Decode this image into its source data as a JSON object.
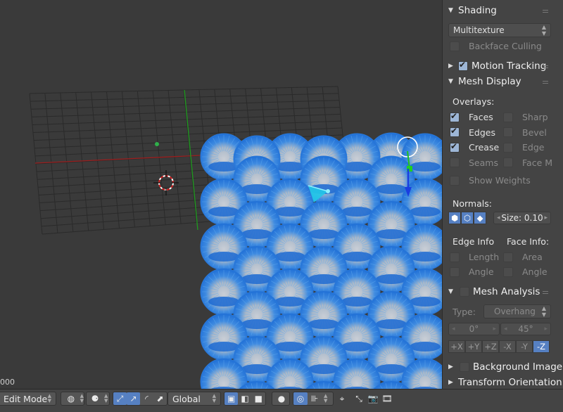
{
  "viewport": {
    "corner_text": "000"
  },
  "shading_panel": {
    "title": "Shading",
    "shading_mode": "Multitexture",
    "backface_culling": {
      "label": "Backface Culling",
      "checked": false
    }
  },
  "motion_tracking": {
    "title": "Motion Tracking",
    "checked": true
  },
  "mesh_display": {
    "title": "Mesh Display",
    "overlays_label": "Overlays:",
    "overlays": [
      {
        "label": "Faces",
        "checked": true
      },
      {
        "label": "Sharp",
        "checked": false
      },
      {
        "label": "Edges",
        "checked": true
      },
      {
        "label": "Bevel",
        "checked": false
      },
      {
        "label": "Crease",
        "checked": true
      },
      {
        "label": "Edge",
        "checked": false
      },
      {
        "label": "Seams",
        "checked": false
      },
      {
        "label": "Face M",
        "checked": false
      }
    ],
    "show_weights": {
      "label": "Show Weights",
      "checked": false
    },
    "normals_label": "Normals:",
    "normals_size": "Size: 0.10",
    "edge_info_label": "Edge Info",
    "face_info_label": "Face Info:",
    "length": "Length",
    "area": "Area",
    "edge_angle": "Angle",
    "face_angle": "Angle"
  },
  "mesh_analysis": {
    "title": "Mesh Analysis",
    "type_label": "Type:",
    "type_value": "Overhang",
    "min_angle": "0°",
    "max_angle": "45°",
    "axes": [
      "+X",
      "+Y",
      "+Z",
      "-X",
      "-Y",
      "-Z"
    ],
    "active_axis": "-Z"
  },
  "background_image": {
    "title": "Background Image"
  },
  "transform_orientation": {
    "title": "Transform Orientation"
  },
  "header_bar": {
    "mode": "Edit Mode",
    "orientation": "Global"
  },
  "colors": {
    "sphere_blue": "#2e7ad8",
    "sphere_light": "#b8c7d6",
    "x_axis": "#b02020",
    "y_axis": "#20a020",
    "active_blue": "#5680c2"
  }
}
